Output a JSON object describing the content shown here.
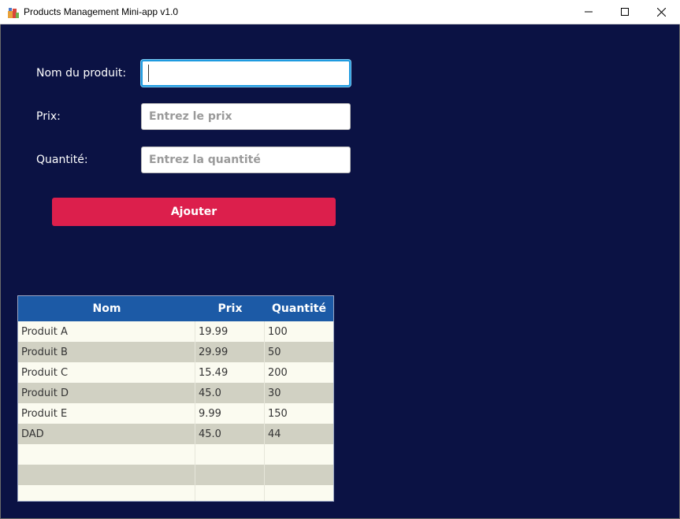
{
  "window": {
    "title": "Products Management Mini-app v1.0",
    "controls": [
      "minimize",
      "maximize",
      "close"
    ]
  },
  "form": {
    "name_label": "Nom du produit:",
    "name_value": "",
    "name_placeholder": "",
    "price_label": "Prix:",
    "price_placeholder": "Entrez le prix",
    "quantity_label": "Quantité:",
    "quantity_placeholder": "Entrez la quantité",
    "add_button_label": "Ajouter"
  },
  "table": {
    "headers": [
      "Nom",
      "Prix",
      "Quantité"
    ],
    "rows": [
      {
        "nom": "Produit A",
        "prix": "19.99",
        "quantite": "100"
      },
      {
        "nom": "Produit B",
        "prix": "29.99",
        "quantite": "50"
      },
      {
        "nom": "Produit C",
        "prix": "15.49",
        "quantite": "200"
      },
      {
        "nom": "Produit D",
        "prix": "45.0",
        "quantite": "30"
      },
      {
        "nom": "Produit E",
        "prix": "9.99",
        "quantite": "150"
      },
      {
        "nom": "DAD",
        "prix": "45.0",
        "quantite": "44"
      },
      {
        "nom": "",
        "prix": "",
        "quantite": ""
      },
      {
        "nom": "",
        "prix": "",
        "quantite": ""
      },
      {
        "nom": "",
        "prix": "",
        "quantite": ""
      }
    ]
  },
  "colors": {
    "background": "#0b1244",
    "accent_button": "#dc1f4c",
    "table_header": "#1c5aa6",
    "row_odd": "#fbfbf0",
    "row_even": "#d1d1c3",
    "focus_border": "#1f9be0"
  },
  "icons": {
    "app": "app-icon",
    "minimize": "minimize-icon",
    "maximize": "maximize-icon",
    "close": "close-icon"
  }
}
